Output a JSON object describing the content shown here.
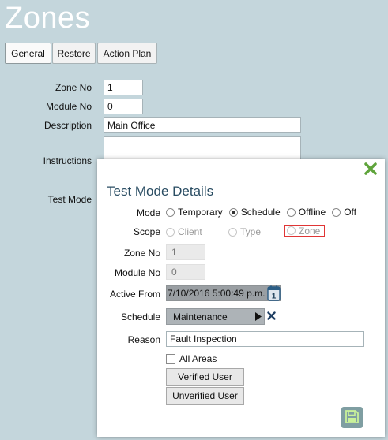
{
  "page": {
    "title": "Zones"
  },
  "tabs": [
    {
      "label": "General"
    },
    {
      "label": "Restore"
    },
    {
      "label": "Action Plan"
    }
  ],
  "form": {
    "zone_no_label": "Zone No",
    "zone_no_value": "1",
    "module_no_label": "Module No",
    "module_no_value": "0",
    "description_label": "Description",
    "description_value": "Main Office",
    "instructions_label": "Instructions",
    "test_mode_label": "Test Mode"
  },
  "dialog": {
    "title": "Test Mode Details",
    "mode_label": "Mode",
    "mode_options": [
      {
        "label": "Temporary"
      },
      {
        "label": "Schedule"
      },
      {
        "label": "Offline"
      },
      {
        "label": "Off"
      }
    ],
    "mode_selected": "Schedule",
    "scope_label": "Scope",
    "scope_options": [
      {
        "label": "Client"
      },
      {
        "label": "Type"
      },
      {
        "label": "Zone"
      }
    ],
    "zone_no_label": "Zone No",
    "zone_no_value": "1",
    "module_no_label": "Module No",
    "module_no_value": "0",
    "active_from_label": "Active From",
    "active_from_value": "7/10/2016 5:00:49 p.m.",
    "schedule_label": "Schedule",
    "schedule_value": "Maintenance",
    "reason_label": "Reason",
    "reason_value": "Fault Inspection",
    "all_areas_label": "All Areas",
    "verified_user_label": "Verified User",
    "unverified_user_label": "Unverified User",
    "calendar_day": "1"
  },
  "icons": {
    "close": "close-icon",
    "calendar": "calendar-icon",
    "play": "play-icon",
    "clear": "clear-icon",
    "save": "save-icon"
  },
  "colors": {
    "background": "#c4d6dc",
    "close_green": "#5fa43b",
    "dialog_title": "#2a4d63",
    "save_button": "#7f9ea2",
    "zone_highlight": "#e03535"
  }
}
